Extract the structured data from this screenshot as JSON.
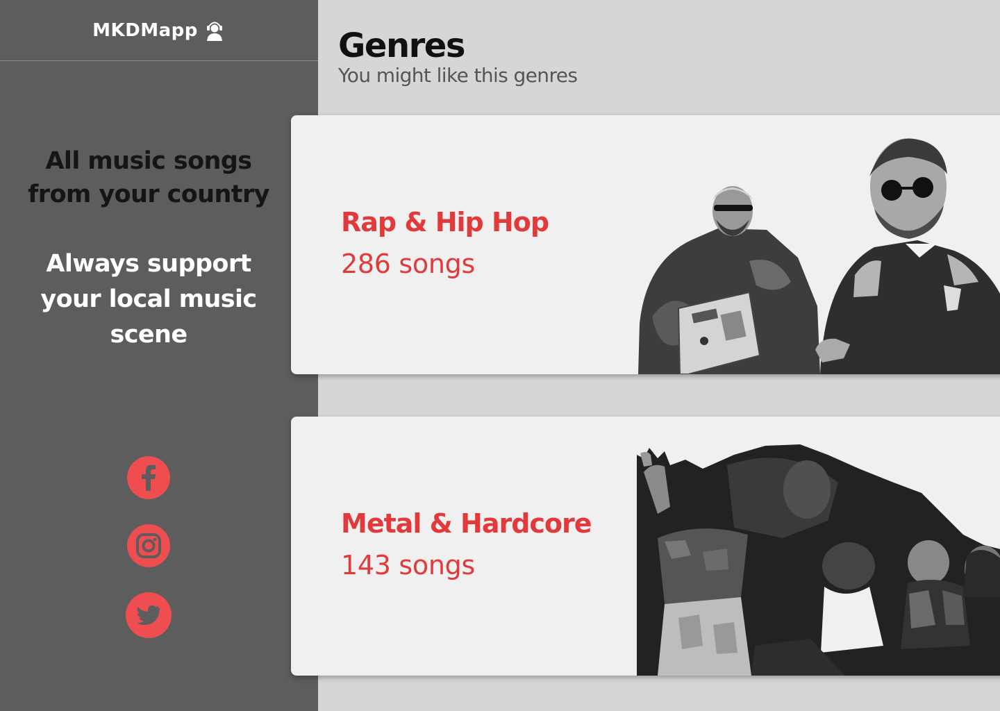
{
  "brand": {
    "name": "MKDMapp",
    "icon": "user-headset-icon"
  },
  "sidebar": {
    "tagline": [
      "All music songs",
      "from your country"
    ],
    "support": [
      "Always support",
      "your local music",
      "scene"
    ],
    "social": [
      {
        "name": "facebook",
        "icon": "facebook-icon"
      },
      {
        "name": "instagram",
        "icon": "instagram-icon"
      },
      {
        "name": "twitter",
        "icon": "twitter-icon"
      }
    ]
  },
  "main": {
    "title": "Genres",
    "subtitle": "You might like this genres",
    "genres": [
      {
        "name": "Rap & Hip Hop",
        "count": "286 songs",
        "image": "rap-hip-hop-photo"
      },
      {
        "name": "Metal & Hardcore",
        "count": "143 songs",
        "image": "metal-hardcore-photo"
      }
    ]
  },
  "colors": {
    "sidebar": "#5d5d5d",
    "page": "#d6d6d6",
    "card": "#f0f0f0",
    "accent": "#e23a3a",
    "social": "#ef4e50"
  }
}
